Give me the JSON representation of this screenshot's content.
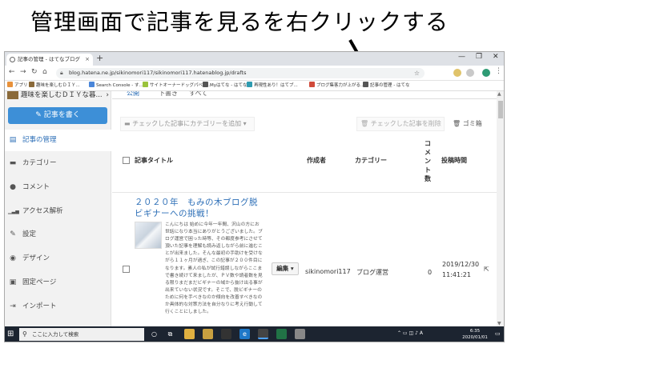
{
  "annotation": {
    "text": "管理画面で記事を見るを右クリックする"
  },
  "browser": {
    "tab_title": "記事の管理 - はてなブログ",
    "tab_close": "×",
    "new_tab": "+",
    "url": "blog.hatena.ne.jp/sikinomori117/sikinomori117.hatenablog.jp/drafts",
    "win_min": "—",
    "win_max": "❐",
    "win_close": "✕",
    "bookmarks": [
      "アプリ",
      "趣味を楽しむＤＩＹ...",
      "Search Console - す...",
      "サイトオーナードッグパベー...",
      "Myはてな - はてな",
      "再現性あり！はてブ...",
      "ブログ集客力が上がる...",
      "記事の管理 - はてな"
    ]
  },
  "sidebar": {
    "blog_name": "趣味を楽しむＤＩＹな暮...",
    "write_button": "記事を書く",
    "items": [
      {
        "label": "記事の管理",
        "icon": "document-icon",
        "glyph": "▤"
      },
      {
        "label": "カテゴリー",
        "icon": "folder-icon",
        "glyph": "▬"
      },
      {
        "label": "コメント",
        "icon": "comment-icon",
        "glyph": "●"
      },
      {
        "label": "アクセス解析",
        "icon": "bar-chart-icon",
        "glyph": "▁▃▅"
      },
      {
        "label": "設定",
        "icon": "wrench-icon",
        "glyph": "✎"
      },
      {
        "label": "デザイン",
        "icon": "palette-icon",
        "glyph": "◉"
      },
      {
        "label": "固定ページ",
        "icon": "page-icon",
        "glyph": "▣"
      },
      {
        "label": "インポート",
        "icon": "import-icon",
        "glyph": "⇥"
      }
    ]
  },
  "main": {
    "tabs": [
      "公開",
      "下書き",
      "すべて"
    ],
    "category_button": "チェックした記事にカテゴリーを追加",
    "delete_button": "チェックした記事を削除",
    "trash_link": "ゴミ箱",
    "columns": {
      "title": "記事タイトル",
      "author": "作成者",
      "category": "カテゴリー",
      "comments": [
        "コ",
        "メ",
        "ン",
        "ト",
        "数"
      ],
      "posted": "投稿時間"
    },
    "post": {
      "title": "２０２０年　もみの木ブログ脱ビギナーへの挑戦！",
      "excerpt": "こんにちは 始めに今年一年間、沢山の方にお世話になり本当にありがとうございました。ブログ運営で困った時等、その都度参考にさせて頂いた記事を理解も読み返しながら前に進むことが出来ました。そんな最初の手助けを受けながら１１ヶ月が過ぎ、この記事が２００件目になります。素人の私が試行錯誤しながらここまで書き続けて来ましたが、ＰＶ数や読者数を見る限りまだまだビギナーの域から抜け出る事が出来ていない状況です。そこで、脱ビギナーのために何を手べきなのか傾向を改善すべきなのか具体的な対策方法を自分なりに考え行動して行くことにしました。",
      "edit": "編集",
      "author": "sikinomori117",
      "category": "ブログ運営",
      "comments": "0",
      "date": "2019/12/30",
      "time": "11:41:21",
      "view_icon": "⇱"
    }
  },
  "taskbar": {
    "search_placeholder": "ここに入力して検索",
    "time": "6:35",
    "date": "2020/01/01"
  },
  "colors": {
    "accent": "#3d8fd7",
    "link": "#2d6fb7",
    "sidebar_bg": "#f2f2f2",
    "taskbar_bg": "#1c2430"
  }
}
